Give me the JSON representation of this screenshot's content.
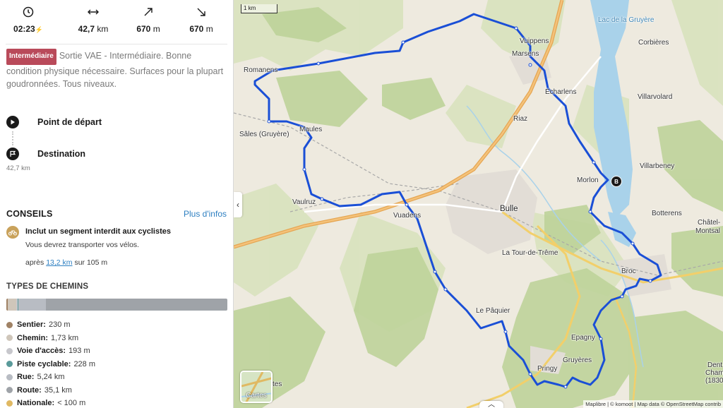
{
  "stats": {
    "duration": "02:23",
    "distance_value": "42,7",
    "distance_unit": "km",
    "up_value": "670",
    "up_unit": "m",
    "down_value": "670",
    "down_unit": "m"
  },
  "description": {
    "badge": "Intermédiaire",
    "text": "Sortie VAE - Intermédiaire. Bonne condition physique nécessaire. Surfaces pour la plupart goudronnées. Tous niveaux."
  },
  "waypoints": {
    "start": "Point de départ",
    "end": "Destination",
    "distance": "42,7 km"
  },
  "conseils": {
    "title": "CONSEILS",
    "more": "Plus d'infos",
    "tip_title": "Inclut un segment interdit aux cyclistes",
    "tip_text": "Vous devrez transporter vos vélos.",
    "after": "après",
    "after_link": "13,2 km",
    "over": "sur 105 m"
  },
  "types": {
    "title": "TYPES DE CHEMINS",
    "items": [
      {
        "name": "Sentier:",
        "value": "230 m",
        "color": "#a08265"
      },
      {
        "name": "Chemin:",
        "value": "1,73 km",
        "color": "#cfc6ba"
      },
      {
        "name": "Voie d'accès:",
        "value": "193 m",
        "color": "#c7c7cc"
      },
      {
        "name": "Piste cyclable:",
        "value": "228 m",
        "color": "#5a9a9a"
      },
      {
        "name": "Rue:",
        "value": "5,24 km",
        "color": "#b8bcc3"
      },
      {
        "name": "Route:",
        "value": "35,1 km",
        "color": "#9fa3a8"
      },
      {
        "name": "Nationale:",
        "value": "< 100 m",
        "color": "#e0b963"
      }
    ],
    "bar_shares": [
      0.005,
      0.04,
      0.005,
      0.005,
      0.123,
      0.822,
      0.0
    ]
  },
  "map": {
    "scale": "1 km",
    "layer_label": "Cartes",
    "attribution": "Maplibre | © komoot | Map data © OpenStreetMap contrib",
    "end_marker": "B",
    "places": {
      "lake": "Lac de la Gruyère",
      "vuippens": "Vuippens",
      "marsens": "Marsens",
      "corbieres": "Corbières",
      "echarlens": "Echarlens",
      "villarvolard": "Villarvolard",
      "romanens": "Romanens",
      "riaz": "Riaz",
      "sales": "Sâles (Gruyère)",
      "maules": "Maules",
      "villarbeney": "Villarbeney",
      "morlon": "Morlon",
      "vaulruz": "Vaulruz",
      "bulle": "Bulle",
      "botterens": "Botterens",
      "chatel": "Châtel-",
      "montsalvens": "Montsal",
      "vuadens": "Vuadens",
      "tourdetreme": "La Tour-de-Trême",
      "broc": "Broc",
      "lepaquier": "Le Pâquier",
      "epagny": "Epagny",
      "gruyeres": "Gruyères",
      "pringy": "Pringy",
      "dent": "Dent",
      "cham": "Cham",
      "alt": "(1830",
      "cut": "tes",
      "cut2": ")"
    }
  }
}
